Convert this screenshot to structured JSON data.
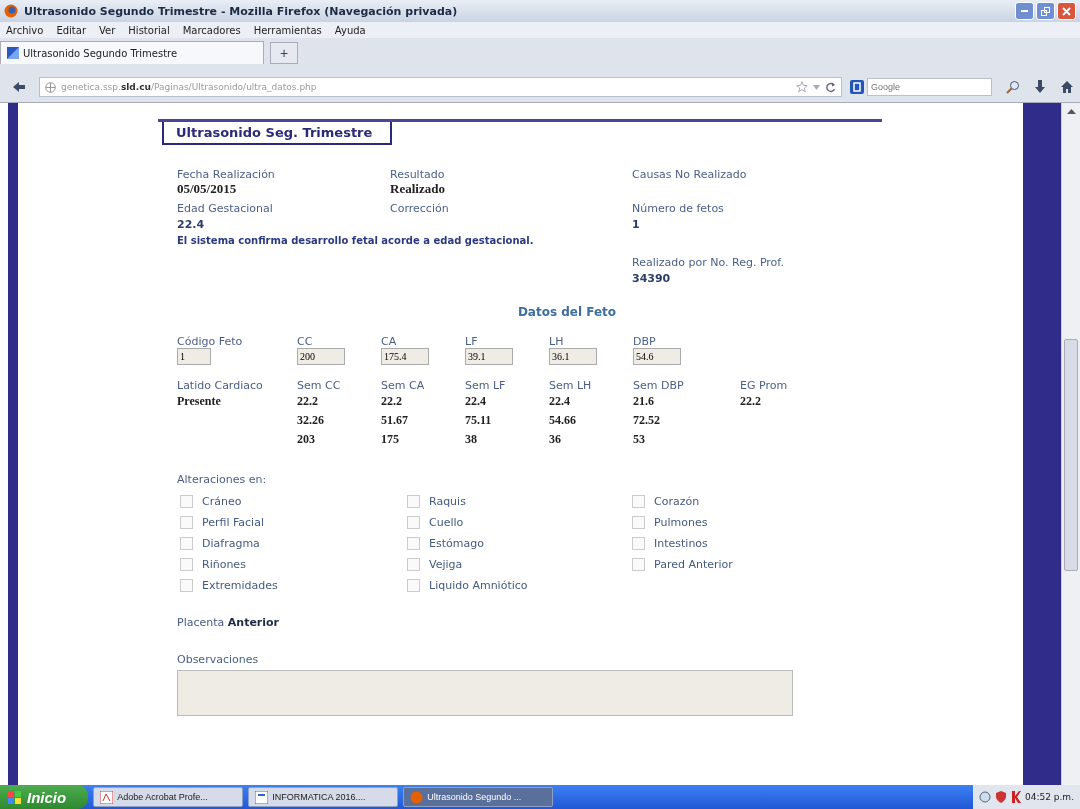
{
  "window": {
    "title": "Ultrasonido Segundo Trimestre - Mozilla Firefox (Navegación privada)"
  },
  "menu": [
    "Archivo",
    "Editar",
    "Ver",
    "Historial",
    "Marcadores",
    "Herramientas",
    "Ayuda"
  ],
  "tabs": [
    {
      "label": "Ultrasonido Segundo Trimestre",
      "selected": true
    }
  ],
  "new_tab": "+",
  "address": {
    "url": "genetica.ssp.**sld.cu**/Paginas/Ultrasonido/ultra_datos.php"
  },
  "search": {
    "placeholder": "Google"
  },
  "page": {
    "heading": "Ultrasonido Seg. Trimestre",
    "fields": [
      {
        "label": "Fecha Realización",
        "value": "05/05/2015",
        "kind": "serif"
      },
      {
        "label": "Resultado",
        "value": "Realizado",
        "kind": "serif"
      },
      {
        "label": "Causas No Realizado"
      },
      {
        "label": "Edad Gestacional",
        "value": "22.4",
        "kind": "sans"
      },
      {
        "label": "Corrección"
      },
      {
        "label": "Número de fetos",
        "value": "1",
        "kind": "sans"
      }
    ],
    "message": "El sistema confirma desarrollo fetal acorde a edad gestacional.",
    "professional": {
      "label": "Realizado por No. Reg. Prof.",
      "value": "34390"
    },
    "fetus_heading": "Datos del Feto",
    "measure_inputs": [
      {
        "label": "Código Feto",
        "value": "1"
      },
      {
        "label": "CC",
        "value": "200"
      },
      {
        "label": "CA",
        "value": "175.4"
      },
      {
        "label": "LF",
        "value": "39.1"
      },
      {
        "label": "LH",
        "value": "36.1"
      },
      {
        "label": "DBP",
        "value": "54.6"
      }
    ],
    "results": [
      {
        "label": "Latido Cardiaco",
        "values": [
          "Presente"
        ]
      },
      {
        "label": "Sem CC",
        "values": [
          "22.2",
          "32.26",
          "203"
        ]
      },
      {
        "label": "Sem CA",
        "values": [
          "22.2",
          "51.67",
          "175"
        ]
      },
      {
        "label": "Sem LF",
        "values": [
          "22.4",
          "75.11",
          "38"
        ]
      },
      {
        "label": "Sem LH",
        "values": [
          "22.4",
          "54.66",
          "36"
        ]
      },
      {
        "label": "Sem DBP",
        "values": [
          "21.6",
          "72.52",
          "53"
        ]
      },
      {
        "label": "EG Prom",
        "values": [
          "22.2"
        ]
      }
    ],
    "alterations_label": "Alteraciones en:",
    "alterations": [
      [
        {
          "label": "Cráneo",
          "checked": false
        },
        {
          "label": "Perfil Facial",
          "checked": false
        },
        {
          "label": "Diafragma",
          "checked": false
        },
        {
          "label": "Riñones",
          "checked": false
        },
        {
          "label": "Extremidades",
          "checked": false
        }
      ],
      [
        {
          "label": "Raquis",
          "checked": false
        },
        {
          "label": "Cuello",
          "checked": false
        },
        {
          "label": "Estómago",
          "checked": false
        },
        {
          "label": "Vejiga",
          "checked": false
        },
        {
          "label": "Liquido Amniótico",
          "checked": false
        }
      ],
      [
        {
          "label": "Corazón",
          "checked": false
        },
        {
          "label": "Pulmones",
          "checked": false
        },
        {
          "label": "Intestinos",
          "checked": false
        },
        {
          "label": "Pared Anterior",
          "checked": false
        }
      ]
    ],
    "placenta": "Placenta **Anterior**",
    "observations_label": "Observaciones"
  },
  "taskbar": {
    "start": "Inicio",
    "tasks": [
      {
        "label": "Adobe Acrobat Profe...",
        "selected": false
      },
      {
        "label": "INFORMATICA 2016....",
        "selected": false
      },
      {
        "label": "Ultrasonido Segundo ...",
        "selected": true
      }
    ],
    "clock": "04:52 p.m."
  }
}
